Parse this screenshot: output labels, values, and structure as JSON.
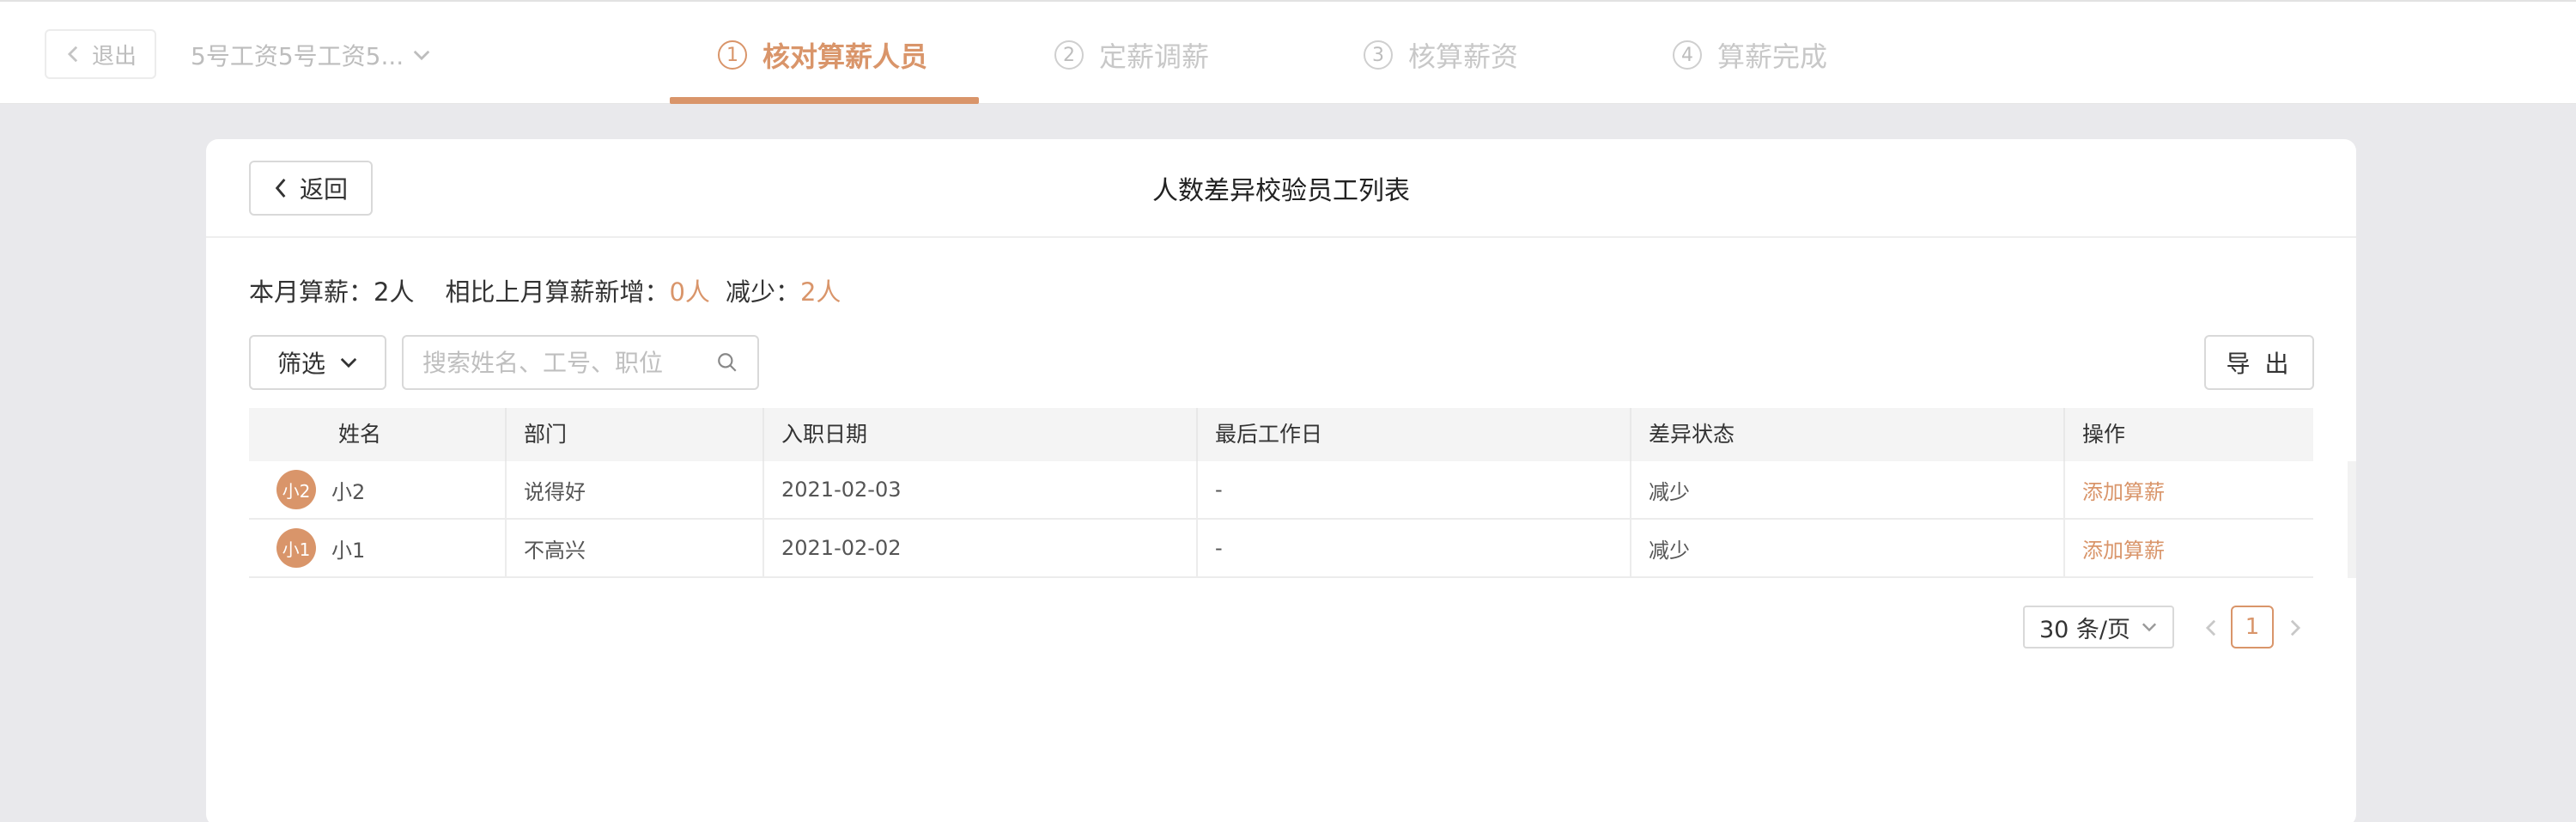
{
  "header": {
    "exit_label": "退出",
    "payroll_name": "5号工资5号工资5...",
    "steps": [
      {
        "num": "1",
        "label": "核对算薪人员",
        "active": true
      },
      {
        "num": "2",
        "label": "定薪调薪",
        "active": false
      },
      {
        "num": "3",
        "label": "核算薪资",
        "active": false
      },
      {
        "num": "4",
        "label": "算薪完成",
        "active": false
      }
    ]
  },
  "card": {
    "back_label": "返回",
    "title": "人数差异校验员工列表"
  },
  "summary": {
    "monthly_label": "本月算薪：",
    "monthly_value": "2人",
    "compare_label": "相比上月算薪新增：",
    "added_value": "0人",
    "reduced_label": "减少：",
    "reduced_value": "2人"
  },
  "toolbar": {
    "filter_label": "筛选",
    "search_placeholder": "搜索姓名、工号、职位",
    "export_label": "导 出"
  },
  "table": {
    "columns": [
      "姓名",
      "部门",
      "入职日期",
      "最后工作日",
      "差异状态",
      "操作"
    ],
    "rows": [
      {
        "avatar": "小2",
        "name": "小2",
        "dept": "说得好",
        "hire_date": "2021-02-03",
        "last_day": "-",
        "status": "减少",
        "action": "添加算薪"
      },
      {
        "avatar": "小1",
        "name": "小1",
        "dept": "不高兴",
        "hire_date": "2021-02-02",
        "last_day": "-",
        "status": "减少",
        "action": "添加算薪"
      }
    ]
  },
  "pagination": {
    "page_size": "30 条/页",
    "current_page": "1"
  },
  "colors": {
    "accent": "#d9956a",
    "background": "#e9e9ec"
  }
}
